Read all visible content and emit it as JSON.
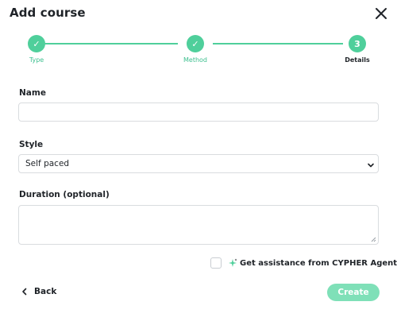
{
  "dialog": {
    "title": "Add course",
    "close_icon": "close-icon"
  },
  "stepper": {
    "steps": [
      {
        "label": "Type",
        "marker": "✓",
        "state": "completed"
      },
      {
        "label": "Method",
        "marker": "✓",
        "state": "completed"
      },
      {
        "label": "Details",
        "marker": "3",
        "state": "current"
      }
    ]
  },
  "form": {
    "name": {
      "label": "Name",
      "value": "",
      "placeholder": ""
    },
    "style": {
      "label": "Style",
      "value": "Self paced"
    },
    "duration": {
      "label": "Duration (optional)",
      "value": "",
      "placeholder": ""
    }
  },
  "assist": {
    "checked": false,
    "icon": "sparkle-icon",
    "label": "Get assistance from CYPHER Agent"
  },
  "footer": {
    "back_label": "Back",
    "create_label": "Create"
  },
  "colors": {
    "accent": "#4fcf9b",
    "accent_light": "#7fe0b8",
    "text": "#1f2328",
    "border": "#d9dcdf"
  }
}
